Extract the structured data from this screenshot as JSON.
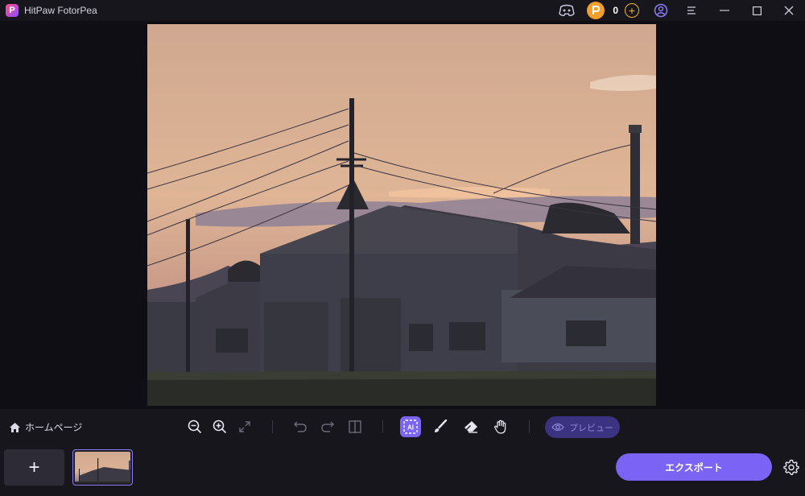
{
  "app": {
    "title": "HitPaw FotorPea"
  },
  "header": {
    "credits": "0"
  },
  "toolbar": {
    "home_label": "ホームページ",
    "preview_label": "プレビュー"
  },
  "bottom": {
    "export_label": "エクスポート",
    "add_label": "+"
  },
  "colors": {
    "accent": "#7b63f6",
    "credit_badge": "#f0a02a",
    "background": "#0f0e14"
  }
}
